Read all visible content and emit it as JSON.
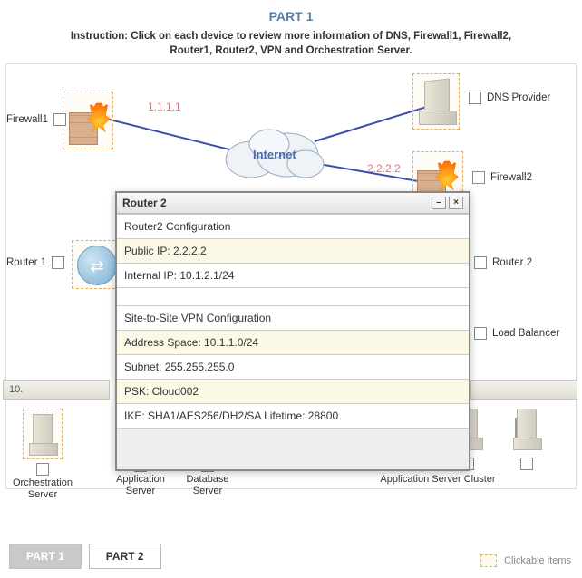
{
  "title": "PART 1",
  "instruction": "Instruction: Click on each device to review more information of DNS, Firewall1, Firewall2, Router1, Router2, VPN and Orchestration Server.",
  "ips": {
    "firewall1": "1.1.1.1",
    "firewall2": "2.2.2.2"
  },
  "internet_label": "Internet",
  "devices": {
    "firewall1": "Firewall1",
    "dns": "DNS Provider",
    "firewall2": "Firewall2",
    "router1": "Router 1",
    "router2": "Router 2",
    "load_balancer": "Load Balancer",
    "orchestration": "Orchestration Server",
    "app_server": "Application Server",
    "db_server": "Database Server",
    "app_cluster": "Application Server Cluster"
  },
  "rack_left_text": "10.",
  "popup": {
    "title": "Router 2",
    "rows": [
      "Router2 Configuration",
      "Public IP: 2.2.2.2",
      "Internal IP: 10.1.2.1/24",
      "Site-to-Site VPN Configuration",
      "Address Space: 10.1.1.0/24",
      "Subnet: 255.255.255.0",
      "PSK: Cloud002",
      "IKE: SHA1/AES256/DH2/SA Lifetime: 28800"
    ]
  },
  "tabs": {
    "part1": "PART 1",
    "part2": "PART 2"
  },
  "legend": "Clickable items",
  "chart_data": {
    "type": "table",
    "title": "Router 2",
    "sections": [
      {
        "heading": "Router2 Configuration",
        "entries": {
          "Public IP": "2.2.2.2",
          "Internal IP": "10.1.2.1/24"
        }
      },
      {
        "heading": "Site-to-Site VPN Configuration",
        "entries": {
          "Address Space": "10.1.1.0/24",
          "Subnet": "255.255.255.0",
          "PSK": "Cloud002",
          "IKE": "SHA1/AES256/DH2/SA Lifetime: 28800"
        }
      }
    ]
  }
}
